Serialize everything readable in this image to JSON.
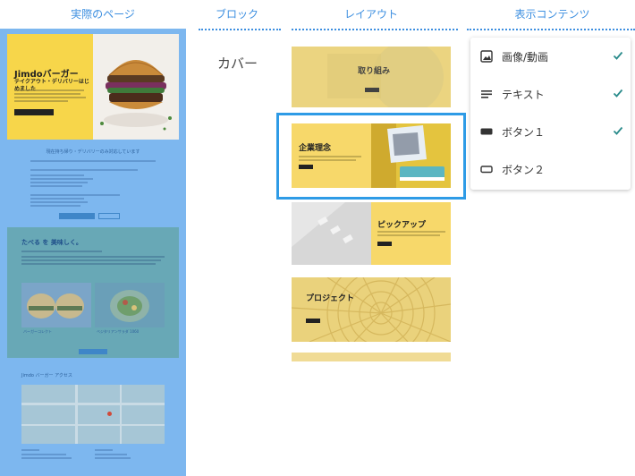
{
  "columns": {
    "actual_page": "実際のページ",
    "block": "ブロック",
    "layout": "レイアウト",
    "contents": "表示コンテンツ"
  },
  "block": {
    "name": "カバー"
  },
  "actual_page": {
    "hero_title": "Jimdoバーガー",
    "hero_subtitle": "テイクアウト・デリバリーはじめました",
    "section1_title": "現在持ち帰り・デリバリーのみ対応しています",
    "section2_title": "たべる を 美味しく。",
    "card1_caption": "バーガーコレクト",
    "card2_caption": "ベジタリアンサラダ 1060",
    "access_title": "Jimdo バーガー アクセス"
  },
  "layouts": [
    {
      "title": "取り組み"
    },
    {
      "title": "企業理念",
      "selected": true
    },
    {
      "title": "ピックアップ"
    },
    {
      "title": "プロジェクト"
    }
  ],
  "contents_panel": {
    "items": [
      {
        "label": "画像/動画",
        "icon": "image-icon",
        "checked": true
      },
      {
        "label": "テキスト",
        "icon": "text-lines-icon",
        "checked": true
      },
      {
        "label": "ボタン１",
        "icon": "filled-button-icon",
        "checked": true
      },
      {
        "label": "ボタン２",
        "icon": "outline-button-icon",
        "checked": false
      }
    ]
  },
  "colors": {
    "accent_blue": "#3d8fe0",
    "selection_border": "#2e9be6",
    "check_teal": "#2a8b8b",
    "cover_yellow": "#f7d64a",
    "actual_page_tint": "#7db7ef"
  }
}
